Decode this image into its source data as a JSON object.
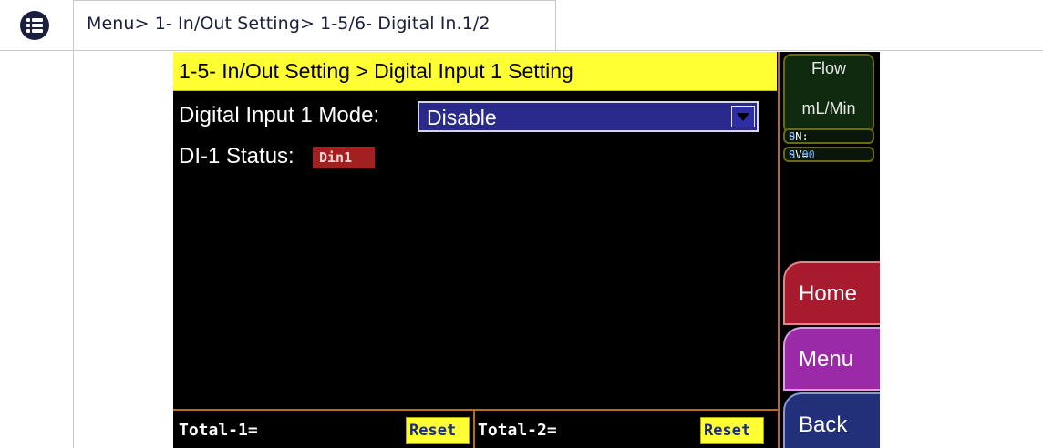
{
  "header": {
    "icon": "list-menu-icon",
    "breadcrumb": "Menu> 1- In/Out Setting> 1-5/6- Digital In.1/2"
  },
  "screen": {
    "title": "1-5- In/Out Setting  > Digital Input 1 Setting",
    "mode_label": "Digital Input 1 Mode:",
    "mode_value": "Disable",
    "status_label": "DI-1 Status:",
    "status_badge": "Din1",
    "total1_label": "Total-1=",
    "total2_label": "Total-2=",
    "reset_label": "Reset",
    "side": {
      "flow_title": "Flow",
      "flow_unit": "mL/Min",
      "sn_label": "SN:",
      "sn_value": "0",
      "sv_label": "SV=",
      "sv_value": "0.00",
      "home": "Home",
      "menu": "Menu",
      "back": "Back"
    }
  },
  "colors": {
    "title_bar": "#ffff33",
    "badge": "#a32020",
    "home": "#a81b2e",
    "menu": "#9a2aa8",
    "back": "#22307a"
  }
}
